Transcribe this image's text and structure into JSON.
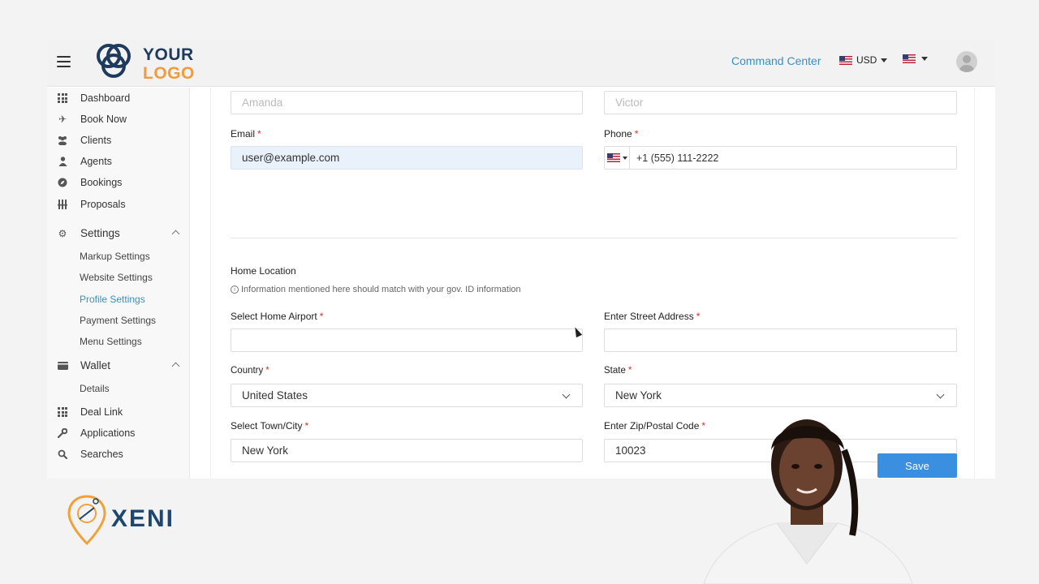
{
  "header": {
    "logo_line1": "YOUR",
    "logo_line2": "LOGO",
    "command_center": "Command Center",
    "currency": "USD"
  },
  "sidebar": {
    "items": [
      {
        "label": "Dashboard",
        "icon": "grid-icon"
      },
      {
        "label": "Book Now",
        "icon": "plane-icon"
      },
      {
        "label": "Clients",
        "icon": "users-icon"
      },
      {
        "label": "Agents",
        "icon": "user-icon"
      },
      {
        "label": "Bookings",
        "icon": "compass-icon"
      },
      {
        "label": "Proposals",
        "icon": "columns-icon"
      }
    ],
    "settings": {
      "label": "Settings",
      "sub_items": [
        "Markup Settings",
        "Website Settings",
        "Profile Settings",
        "Payment Settings",
        "Menu Settings"
      ],
      "active": "Profile Settings"
    },
    "wallet": {
      "label": "Wallet",
      "sub_items": [
        "Details"
      ]
    },
    "bottom_items": [
      {
        "label": "Deal Link",
        "icon": "grid-icon"
      },
      {
        "label": "Applications",
        "icon": "wrench-icon"
      },
      {
        "label": "Searches",
        "icon": "search-icon"
      }
    ]
  },
  "form": {
    "first_name_value": "Amanda",
    "last_name_value": "Victor",
    "email_label": "Email",
    "email_value": "user@example.com",
    "phone_label": "Phone",
    "phone_value": "+1 (555) 111-2222",
    "home_location_title": "Home Location",
    "info_note": "Information mentioned here should match with your gov. ID information",
    "home_airport_label": "Select Home Airport",
    "street_address_label": "Enter Street Address",
    "country_label": "Country",
    "country_value": "United States",
    "state_label": "State",
    "state_value": "New York",
    "city_label": "Select Town/City",
    "city_value": "New York",
    "zip_label": "Enter Zip/Postal Code",
    "zip_value": "10023",
    "required_mark": "*",
    "save_label": "Save"
  },
  "brand": {
    "name": "XENI"
  },
  "colors": {
    "accent": "#3a90c0",
    "button": "#3b8fe0",
    "required": "#d9302c",
    "logo_navy": "#1e3a5c",
    "logo_orange": "#f19a3e"
  }
}
